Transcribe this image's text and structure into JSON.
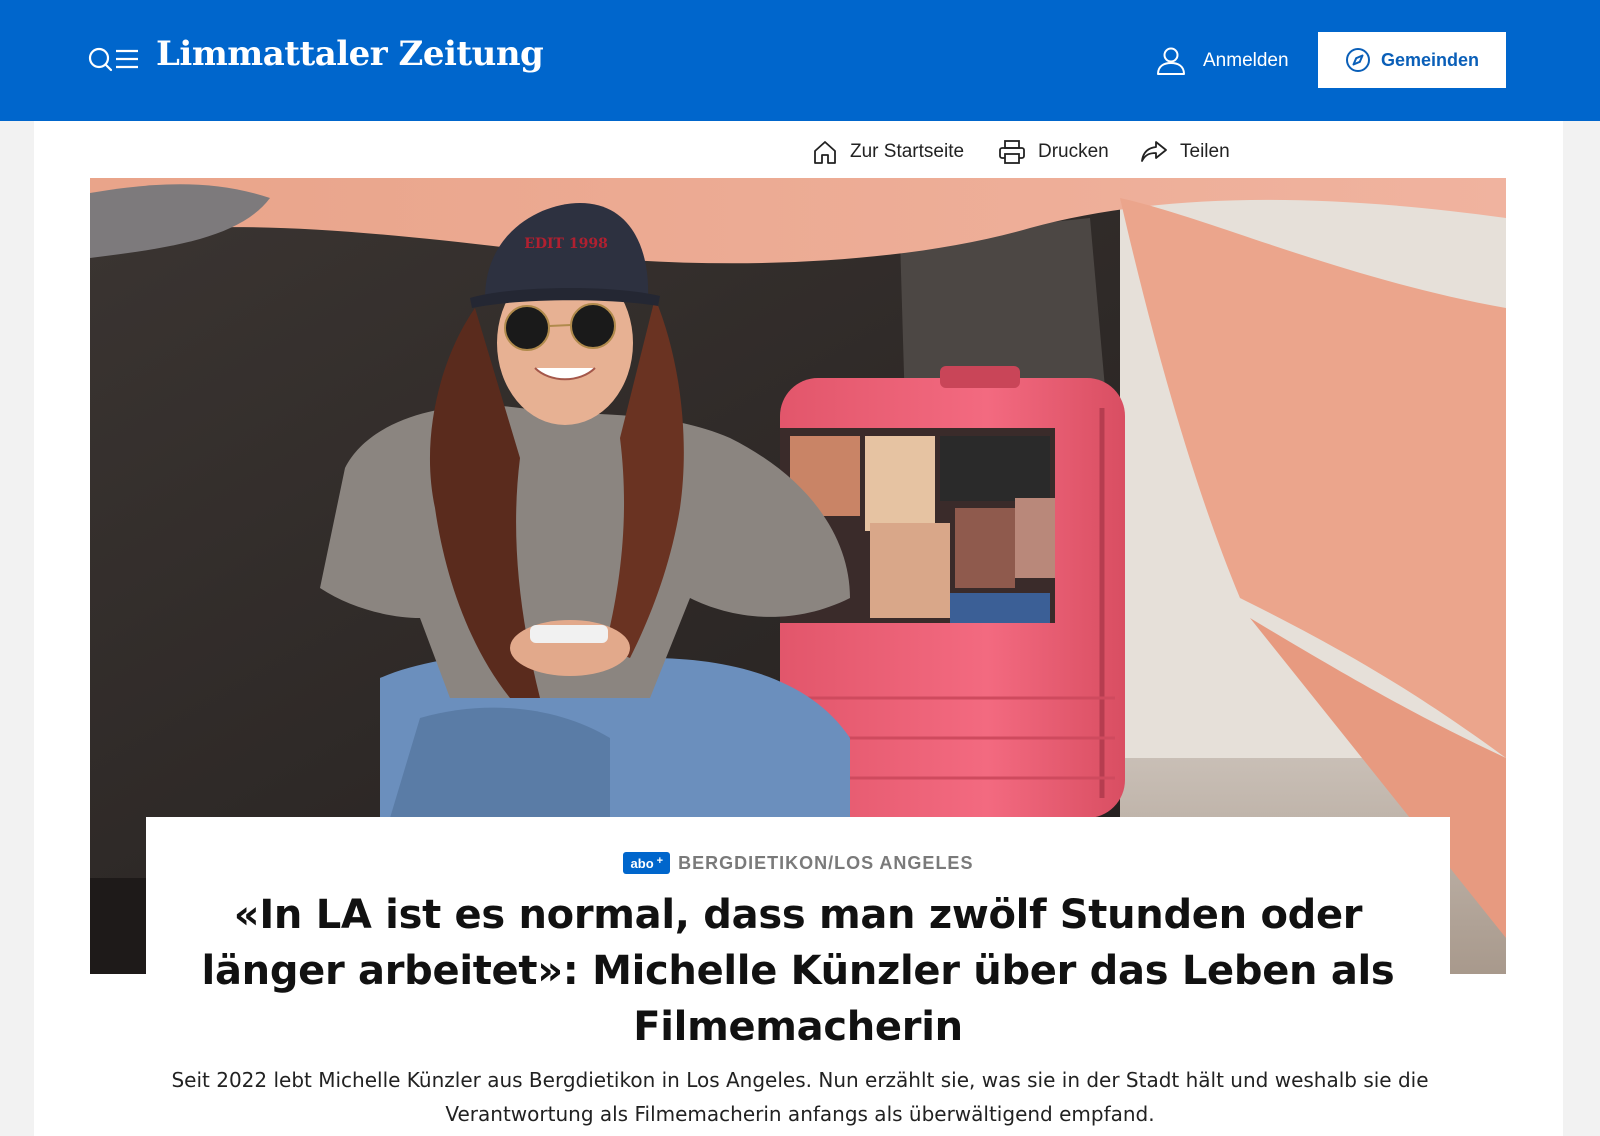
{
  "header": {
    "logo": "Limmattaler Zeitung",
    "login_label": "Anmelden",
    "gemeinden_label": "Gemeinden"
  },
  "toolbar": {
    "home_label": "Zur Startseite",
    "print_label": "Drucken",
    "share_label": "Teilen"
  },
  "article": {
    "badge": "abo",
    "badge_plus": "+",
    "kicker": "BERGDIETIKON/LOS ANGELES",
    "title": "«In LA ist es normal, dass man zwölf Stunden oder länger arbeitet»: Michelle Künzler über das Leben als Filmemacherin",
    "lead": "Seit 2022 lebt Michelle Künzler aus Bergdietikon in Los Angeles. Nun erzählt sie, was sie in der Stadt hält und weshalb sie die Verantwortung als Filmemacherin anfangs als überwältigend empfand."
  },
  "colors": {
    "brand_blue": "#0066cc",
    "kicker_gray": "#7a7a7a"
  },
  "icons": [
    "search-icon",
    "menu-icon",
    "user-icon",
    "compass-icon",
    "home-icon",
    "printer-icon",
    "share-icon"
  ]
}
